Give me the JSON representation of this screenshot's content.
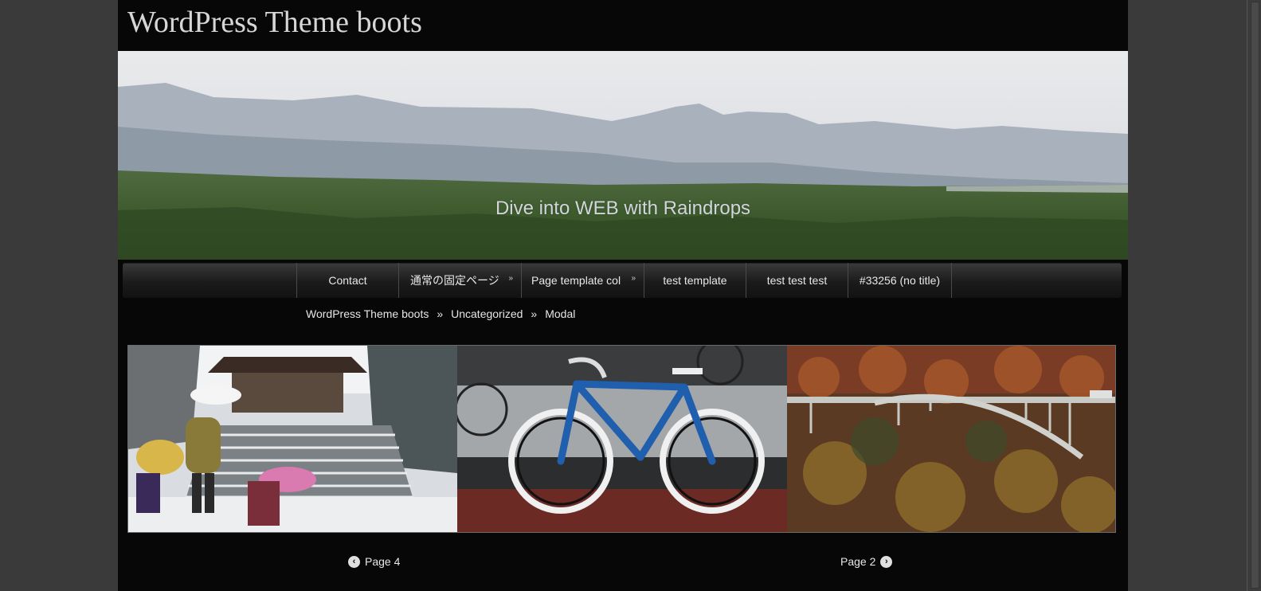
{
  "site": {
    "title": "WordPress Theme boots",
    "tagline": "Dive into WEB with Raindrops"
  },
  "nav": {
    "items": [
      {
        "label": "Contact",
        "has_submenu": false
      },
      {
        "label": "通常の固定ページ",
        "has_submenu": true
      },
      {
        "label": "Page template col",
        "has_submenu": true
      },
      {
        "label": "test template",
        "has_submenu": false
      },
      {
        "label": "test test test",
        "has_submenu": false
      },
      {
        "label": "#33256 (no title)",
        "has_submenu": false
      }
    ]
  },
  "breadcrumb": {
    "items": [
      "WordPress Theme boots",
      "Uncategorized",
      "Modal"
    ],
    "separator": "»"
  },
  "gallery": {
    "photos": [
      {
        "subject": "snowy shrine steps with umbrellas"
      },
      {
        "subject": "blue road bicycle parked"
      },
      {
        "subject": "arch bridge over autumn gorge"
      }
    ]
  },
  "pagination": {
    "prev_label": "Page 4",
    "next_label": "Page 2",
    "prev_icon": "arrow-left-circle-icon",
    "next_icon": "arrow-right-circle-icon"
  },
  "colors": {
    "page_bg": "#070707",
    "outer_bg": "#3a3a3a",
    "text": "#e6e6e6"
  }
}
